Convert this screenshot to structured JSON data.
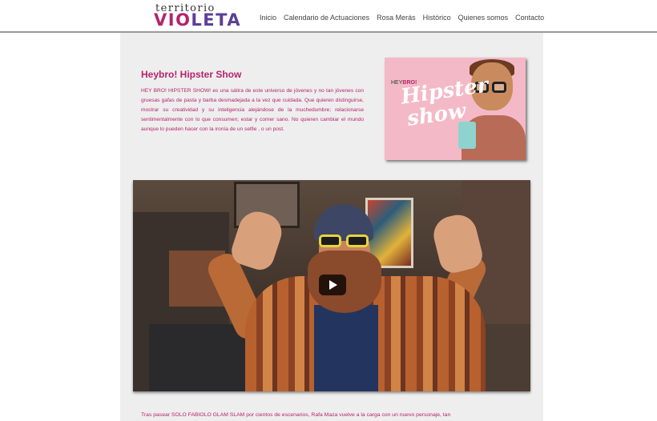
{
  "header": {
    "logo_top": "territorio",
    "logo_part1": "VIO",
    "logo_part2": "LETA",
    "nav": [
      "Inicio",
      "Calendario de Actuaciones",
      "Rosa Merás",
      "Histórico",
      "Quienes somos",
      "Contacto"
    ]
  },
  "article": {
    "title": "Heybro! Hipster Show",
    "description": "HEY BRO! HIPSTER SHOW! es una sátira de este universo de jóvenes y no tan jóvenes con gruesas gafas de pasta y barba desmadejada a la vez que cuidada. Que quieren distinguirse, mostrar su creatividad y su inteligencia alejándose de la muchedumbre; relacionarse sentimentalmente con lo que consumen; estar y comer sano. No quieren cambiar el mundo aunque lo pueden hacer con la ironía de un selfie , o un post.",
    "footer_text": "Tras pasear SOLO FABIOLO GLAM SLAM por cientos de escenarios, Rafa Maza vuelve a la carga con un nuevo personaje, tan"
  },
  "poster": {
    "brand_prefix": "HEY",
    "brand_emph": "BRO!",
    "script_line1": "Hipster",
    "script_line2": "show"
  },
  "colors": {
    "accent": "#b5236c",
    "purple": "#5a3f98",
    "content_bg": "#eeeeee",
    "poster_bg": "#f4b9c6"
  }
}
